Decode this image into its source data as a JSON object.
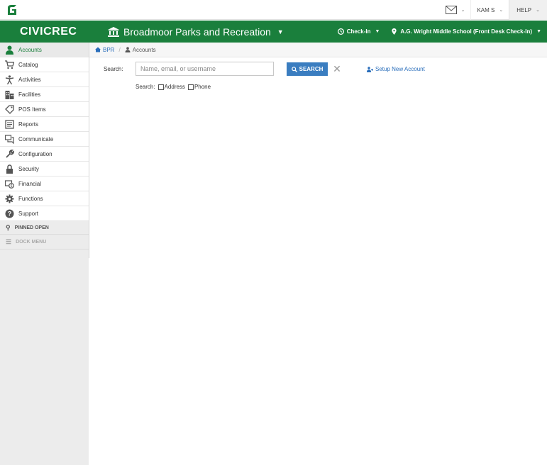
{
  "top": {
    "user_label": "KAM S",
    "help_label": "HELP"
  },
  "header": {
    "brand": "CIVICREC",
    "org_name": "Broadmoor Parks and Recreation",
    "checkin_label": "Check-In",
    "location_label": "A.G. Wright Middle School (Front Desk Check-In)",
    "accent_color": "#1a7f3c"
  },
  "sidebar": {
    "items": [
      {
        "label": "Accounts",
        "icon": "person-icon"
      },
      {
        "label": "Catalog",
        "icon": "cart-icon"
      },
      {
        "label": "Activities",
        "icon": "activity-icon"
      },
      {
        "label": "Facilities",
        "icon": "building-icon"
      },
      {
        "label": "POS Items",
        "icon": "tag-icon"
      },
      {
        "label": "Reports",
        "icon": "report-icon"
      },
      {
        "label": "Communicate",
        "icon": "chat-icon"
      },
      {
        "label": "Configuration",
        "icon": "wrench-icon"
      },
      {
        "label": "Security",
        "icon": "lock-icon"
      },
      {
        "label": "Financial",
        "icon": "money-icon"
      },
      {
        "label": "Functions",
        "icon": "gear-icon"
      },
      {
        "label": "Support",
        "icon": "question-icon"
      }
    ],
    "pinned_label": "PINNED OPEN",
    "dock_label": "DOCK MENU"
  },
  "breadcrumb": {
    "root": "BPR",
    "current": "Accounts"
  },
  "search": {
    "label": "Search:",
    "placeholder": "Name, email, or username",
    "value": "",
    "button_label": "SEARCH",
    "setup_label": "Setup New Account",
    "options_label": "Search:",
    "option_address": "Address",
    "option_phone": "Phone"
  }
}
